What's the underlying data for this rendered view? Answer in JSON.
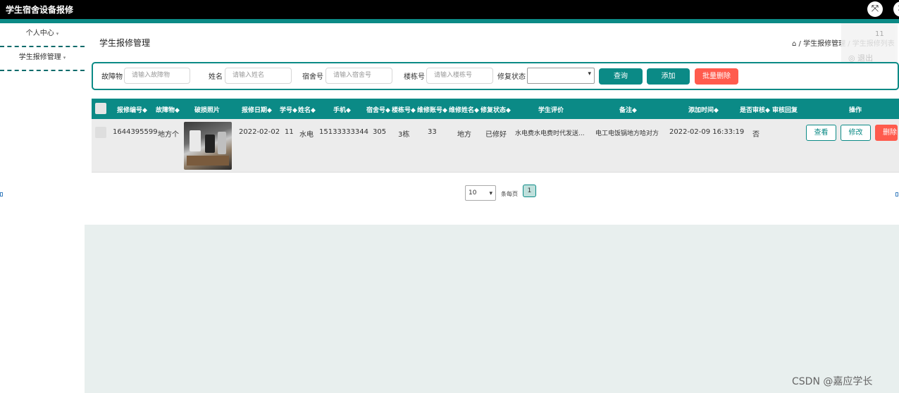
{
  "app": {
    "title": "学生宿舍设备报修",
    "expand_icon": "⤧",
    "close_icon": "✕"
  },
  "sidebar": {
    "items": [
      {
        "label": "个人中心"
      },
      {
        "label": "学生报修管理"
      }
    ],
    "caret": "▾"
  },
  "header": {
    "page_title": "学生报修管理",
    "breadcrumb": "⌂ / 学生报修管理 / 学生报修列表"
  },
  "user_menu": {
    "num": "11",
    "logout": "◎ 退出"
  },
  "search": {
    "fields": [
      {
        "label": "故障物",
        "placeholder": "请输入故障物"
      },
      {
        "label": "姓名",
        "placeholder": "请输入姓名"
      },
      {
        "label": "宿舍号",
        "placeholder": "请输入宿舍号"
      },
      {
        "label": "楼栋号",
        "placeholder": "请输入楼栋号"
      }
    ],
    "status_label": "修复状态",
    "status_value": "",
    "buttons": {
      "query": "查询",
      "add": "添加",
      "batch_delete": "批量删除"
    }
  },
  "table": {
    "headers": [
      "报修编号◆",
      "故障物◆",
      "破损照片",
      "报修日期◆",
      "学号◆",
      "姓名◆",
      "手机◆",
      "宿舍号◆",
      "楼栋号◆",
      "维修账号◆",
      "维修姓名◆",
      "修复状态◆",
      "学生评价",
      "备注◆",
      "添加时间◆",
      "是否审核◆",
      "审核回复",
      "操作"
    ],
    "rows": [
      {
        "cells": [
          "1644395599",
          "地方个",
          "2022-02-02",
          "11",
          "水电",
          "15133333344",
          "305",
          "3栋",
          "33",
          "地方",
          "已修好",
          "水电费水电费时代发送...",
          "电工电饭锅地方哈对方",
          "2022-02-09 16:33:19",
          "否"
        ],
        "actions": {
          "view": "查看",
          "edit": "修改",
          "delete": "删除"
        }
      }
    ]
  },
  "pagination": {
    "page_size": "10",
    "page_size_label": "条每页",
    "current_page": "1"
  },
  "watermark": "CSDN @嘉应学长",
  "colors": {
    "accent": "#0b8a86",
    "danger": "#ff5b4d",
    "content_bg": "#e8efee"
  }
}
